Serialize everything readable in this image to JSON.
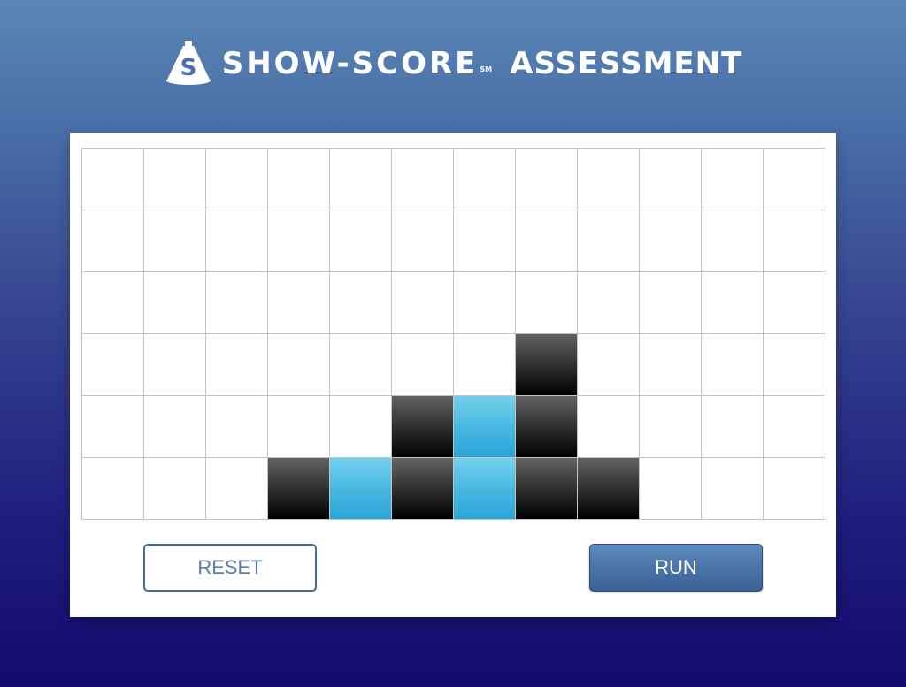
{
  "header": {
    "logo_icon": "show-score-cone-logo",
    "brand": "SHOW-SCORE",
    "service_mark": "SM",
    "title_suffix": "ASSESSMENT"
  },
  "grid": {
    "columns": 12,
    "rows": 6,
    "colors": {
      "empty": "#ffffff",
      "black": "#000000",
      "blue": "#36ade0",
      "line": "#c4c4c4"
    },
    "cells": [
      [
        "empty",
        "empty",
        "empty",
        "empty",
        "empty",
        "empty",
        "empty",
        "empty",
        "empty",
        "empty",
        "empty",
        "empty"
      ],
      [
        "empty",
        "empty",
        "empty",
        "empty",
        "empty",
        "empty",
        "empty",
        "empty",
        "empty",
        "empty",
        "empty",
        "empty"
      ],
      [
        "empty",
        "empty",
        "empty",
        "empty",
        "empty",
        "empty",
        "empty",
        "empty",
        "empty",
        "empty",
        "empty",
        "empty"
      ],
      [
        "empty",
        "empty",
        "empty",
        "empty",
        "empty",
        "empty",
        "empty",
        "black",
        "empty",
        "empty",
        "empty",
        "empty"
      ],
      [
        "empty",
        "empty",
        "empty",
        "empty",
        "empty",
        "black",
        "blue",
        "black",
        "empty",
        "empty",
        "empty",
        "empty"
      ],
      [
        "empty",
        "empty",
        "empty",
        "black",
        "blue",
        "black",
        "blue",
        "black",
        "black",
        "empty",
        "empty",
        "empty"
      ]
    ]
  },
  "buttons": {
    "reset_label": "RESET",
    "run_label": "RUN"
  }
}
